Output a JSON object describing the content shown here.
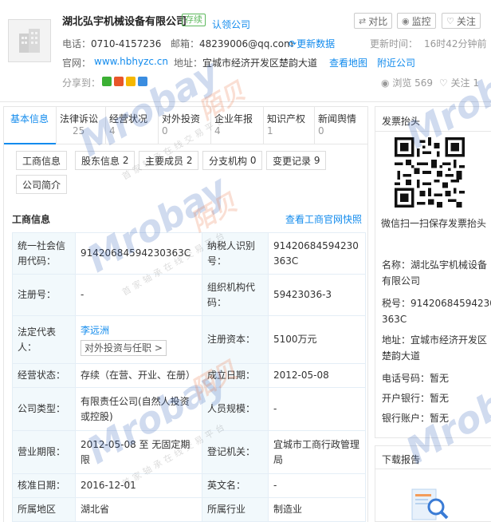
{
  "header": {
    "company_name": "湖北弘宇机械设备有限公司",
    "status": "存续",
    "claim": "认领公司",
    "buttons": {
      "compare": "对比",
      "monitor": "监控",
      "follow": "关注"
    },
    "phone_label": "电话：",
    "phone": "0710-4157236",
    "email_label": "邮箱：",
    "email": "48239006@qq.com",
    "more_data": "更新数据",
    "update_label": "更新时间：",
    "update_time": "16时42分钟前",
    "website_label": "官网：",
    "website": "www.hbhyzc.cn",
    "address_label": "地址：",
    "address": "宜城市经济开发区楚韵大道",
    "view_map": "查看地图",
    "nearby": "附近公司",
    "share_label": "分享到：",
    "views_label": "浏览",
    "views": "569",
    "follow_text": "关注",
    "follow_count": "1"
  },
  "tabs": [
    {
      "label": "基本信息",
      "count": ""
    },
    {
      "label": "法律诉讼",
      "count": "25"
    },
    {
      "label": "经营状况",
      "count": "4"
    },
    {
      "label": "对外投资",
      "count": "0"
    },
    {
      "label": "企业年报",
      "count": "4"
    },
    {
      "label": "知识产权",
      "count": "1"
    },
    {
      "label": "新闻舆情",
      "count": "0"
    }
  ],
  "subtabs": [
    {
      "label": "工商信息"
    },
    {
      "label": "股东信息",
      "count": "2"
    },
    {
      "label": "主要成员",
      "count": "2"
    },
    {
      "label": "分支机构",
      "count": "0"
    },
    {
      "label": "变更记录",
      "count": "9"
    },
    {
      "label": "公司简介"
    }
  ],
  "section": {
    "title": "工商信息",
    "link": "查看工商官网快照"
  },
  "table": {
    "r1": {
      "l1": "统一社会信用代码：",
      "v1": "91420684594230363C",
      "l2": "纳税人识别号：",
      "v2": "91420684594230363C"
    },
    "r2": {
      "l1": "注册号：",
      "v1": "-",
      "l2": "组织机构代码：",
      "v2": "59423036-3"
    },
    "r3": {
      "l1": "法定代表人：",
      "v1": "李远洲",
      "btn": "对外投资与任职 >",
      "l2": "注册资本：",
      "v2": "5100万元"
    },
    "r4": {
      "l1": "经营状态：",
      "v1": "存续（在营、开业、在册）",
      "l2": "成立日期：",
      "v2": "2012-05-08"
    },
    "r5": {
      "l1": "公司类型：",
      "v1": "有限责任公司(自然人投资或控股)",
      "l2": "人员规模：",
      "v2": "-"
    },
    "r6": {
      "l1": "营业期限：",
      "v1": "2012-05-08 至 无固定期限",
      "l2": "登记机关：",
      "v2": "宜城市工商行政管理局"
    },
    "r7": {
      "l1": "核准日期：",
      "v1": "2016-12-01",
      "l2": "英文名：",
      "v2": "-"
    },
    "r8": {
      "l1": "所属地区",
      "v1": "湖北省",
      "l2": "所属行业",
      "v2": "制造业"
    }
  },
  "invoice": {
    "title": "发票抬头",
    "caption": "微信扫一扫保存发票抬头",
    "name": "名称：湖北弘宇机械设备有限公司",
    "tax": "税号：91420684594230363C",
    "address": "地址：宜城市经济开发区楚韵大道",
    "phone": "电话号码：暂无",
    "bank": "开户银行：暂无",
    "account": "银行账户：暂无"
  },
  "download": {
    "title": "下载报告"
  },
  "watermark": {
    "brand": "Mrobay",
    "cn": "陌贝",
    "slogan": "首家轴承在线交易平台"
  },
  "colors": {
    "accent": "#128bed",
    "status": "#5cb85c",
    "label_bg": "#f2f9fc"
  }
}
